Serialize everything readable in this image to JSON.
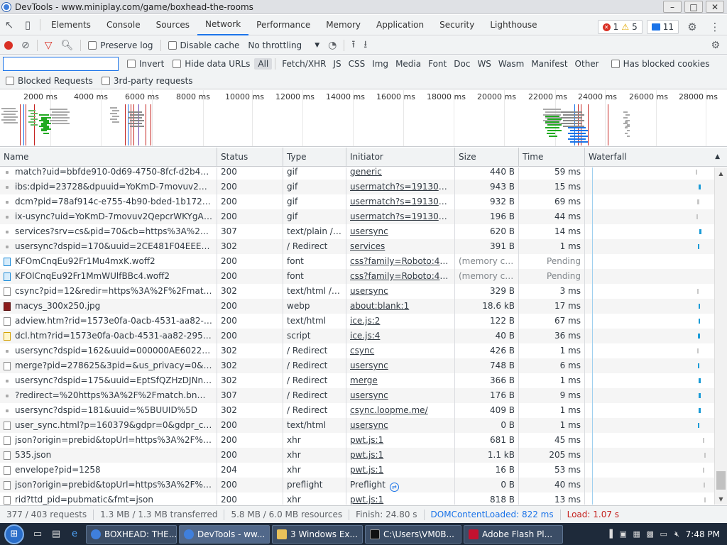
{
  "window": {
    "title": "DevTools - www.miniplay.com/game/boxhead-the-rooms",
    "min": "–",
    "max": "□",
    "close": "✕"
  },
  "tabs": [
    "Elements",
    "Console",
    "Sources",
    "Network",
    "Performance",
    "Memory",
    "Application",
    "Security",
    "Lighthouse"
  ],
  "badges": {
    "errors": "1",
    "warnings": "5",
    "messages": "11"
  },
  "toolbar": {
    "preserve_log": "Preserve log",
    "disable_cache": "Disable cache",
    "throttling": "No throttling"
  },
  "filter": {
    "value": "",
    "invert": "Invert",
    "hide_data_urls": "Hide data URLs",
    "types": [
      "All",
      "Fetch/XHR",
      "JS",
      "CSS",
      "Img",
      "Media",
      "Font",
      "Doc",
      "WS",
      "Wasm",
      "Manifest",
      "Other"
    ],
    "has_blocked_cookies": "Has blocked cookies",
    "blocked_requests": "Blocked Requests",
    "third_party": "3rd-party requests"
  },
  "overview_ticks": [
    "2000 ms",
    "4000 ms",
    "6000 ms",
    "8000 ms",
    "10000 ms",
    "12000 ms",
    "14000 ms",
    "16000 ms",
    "18000 ms",
    "20000 ms",
    "22000 ms",
    "24000 ms",
    "26000 ms",
    "28000 ms"
  ],
  "columns": {
    "name": "Name",
    "status": "Status",
    "type": "Type",
    "initiator": "Initiator",
    "size": "Size",
    "time": "Time",
    "waterfall": "Waterfall"
  },
  "rows": [
    {
      "name": "match?uid=bbfde910-0d69-4750-8fcf-d2b4ac631...",
      "icon": "dot",
      "status": "200",
      "type": "gif",
      "initiator": "generic",
      "init_link": true,
      "size": "440 B",
      "time": "59 ms",
      "wf": "grey"
    },
    {
      "name": "ibs:dpid=23728&dpuuid=YoKmD-7movuv2Qepcr...",
      "icon": "dot",
      "status": "200",
      "type": "gif",
      "initiator": "usermatch?s=191306&cb...",
      "init_link": true,
      "size": "943 B",
      "time": "15 ms",
      "wf": "blue"
    },
    {
      "name": "dcm?pid=78af914c-e755-4b90-bded-1b172aedc7...",
      "icon": "dot",
      "status": "200",
      "type": "gif",
      "initiator": "usermatch?s=191306&cb...",
      "init_link": true,
      "size": "932 B",
      "time": "69 ms",
      "wf": "grey"
    },
    {
      "name": "ix-usync?uid=YoKmD-7movuv2QepcrWKYgAA%2...",
      "icon": "dot",
      "status": "200",
      "type": "gif",
      "initiator": "usermatch?s=191306&cb...",
      "init_link": true,
      "size": "196 B",
      "time": "44 ms",
      "wf": "grey"
    },
    {
      "name": "services?srv=cs&pid=70&cb=https%3A%2F%2Fm...",
      "icon": "dot",
      "status": "307",
      "type": "text/plain / R...",
      "initiator": "usersync",
      "init_link": true,
      "size": "620 B",
      "time": "14 ms",
      "wf": "blue"
    },
    {
      "name": "usersync?dspid=170&uuid=2CE481F04EEE40A68...",
      "icon": "dot",
      "status": "302",
      "type": "/ Redirect",
      "initiator": "services",
      "init_link": true,
      "size": "391 B",
      "time": "1 ms",
      "wf": "blue"
    },
    {
      "name": "KFOmCnqEu92Fr1Mu4mxK.woff2",
      "icon": "font",
      "status": "200",
      "type": "font",
      "initiator": "css?family=Roboto:400,7...",
      "init_link": true,
      "size": "(memory cac...",
      "size_muted": true,
      "time": "Pending",
      "time_muted": true,
      "wf": "none"
    },
    {
      "name": "KFOlCnqEu92Fr1MmWUlfBBc4.woff2",
      "icon": "font",
      "status": "200",
      "type": "font",
      "initiator": "css?family=Roboto:400,7...",
      "init_link": true,
      "size": "(memory cac...",
      "size_muted": true,
      "time": "Pending",
      "time_muted": true,
      "wf": "none"
    },
    {
      "name": "csync?pid=12&redir=https%3A%2F%2Fmatch.bn...",
      "icon": "doc",
      "status": "302",
      "type": "text/html / R...",
      "initiator": "usersync",
      "init_link": true,
      "size": "329 B",
      "time": "3 ms",
      "wf": "grey"
    },
    {
      "name": "macys_300x250.jpg",
      "icon": "img",
      "status": "200",
      "type": "webp",
      "initiator": "about:blank:1",
      "init_link": true,
      "size": "18.6 kB",
      "time": "17 ms",
      "wf": "blue"
    },
    {
      "name": "adview.htm?rid=1573e0fa-0acb-4531-aa82-29581...",
      "icon": "doc",
      "status": "200",
      "type": "text/html",
      "initiator": "ice.js:2",
      "init_link": true,
      "size": "122 B",
      "time": "67 ms",
      "wf": "blue"
    },
    {
      "name": "dcl.htm?rid=1573e0fa-0acb-4531-aa82-295812b0...",
      "icon": "script",
      "status": "200",
      "type": "script",
      "initiator": "ice.js:4",
      "init_link": true,
      "size": "40 B",
      "time": "36 ms",
      "wf": "blue"
    },
    {
      "name": "usersync?dspid=162&uuid=000000AE602265C5",
      "icon": "dot",
      "status": "302",
      "type": "/ Redirect",
      "initiator": "csync",
      "init_link": true,
      "size": "426 B",
      "time": "1 ms",
      "wf": "grey"
    },
    {
      "name": "merge?pid=278625&3pid=&us_privacy=0&gdpr=...",
      "icon": "doc",
      "status": "302",
      "type": "/ Redirect",
      "initiator": "usersync",
      "init_link": true,
      "size": "748 B",
      "time": "6 ms",
      "wf": "blue"
    },
    {
      "name": "usersync?dspid=175&uuid=EptSfQZHzDJNnftQSE...",
      "icon": "dot",
      "status": "302",
      "type": "/ Redirect",
      "initiator": "merge",
      "init_link": true,
      "size": "366 B",
      "time": "1 ms",
      "wf": "blue"
    },
    {
      "name": "?redirect=%20https%3A%2F%2Fmatch.bnmla.com...",
      "icon": "dot",
      "status": "307",
      "type": "/ Redirect",
      "initiator": "usersync",
      "init_link": true,
      "size": "176 B",
      "time": "9 ms",
      "wf": "blue"
    },
    {
      "name": "usersync?dspid=181&uuid=%5BUUID%5D",
      "icon": "dot",
      "status": "302",
      "type": "/ Redirect",
      "initiator": "csync.loopme.me/",
      "init_link": true,
      "size": "409 B",
      "time": "1 ms",
      "wf": "blue"
    },
    {
      "name": "user_sync.html?p=160379&gdpr=0&gdpr_consen...",
      "icon": "doc",
      "status": "200",
      "type": "text/html",
      "initiator": "usersync",
      "init_link": true,
      "size": "0 B",
      "time": "1 ms",
      "wf": "blue"
    },
    {
      "name": "json?origin=prebid&topUrl=https%3A%2F%2Fww...",
      "icon": "doc",
      "status": "200",
      "type": "xhr",
      "initiator": "pwt.js:1",
      "init_link": true,
      "size": "681 B",
      "time": "45 ms",
      "wf": "grey"
    },
    {
      "name": "535.json",
      "icon": "doc",
      "status": "200",
      "type": "xhr",
      "initiator": "pwt.js:1",
      "init_link": true,
      "size": "1.1 kB",
      "time": "205 ms",
      "wf": "grey"
    },
    {
      "name": "envelope?pid=1258",
      "icon": "doc",
      "status": "204",
      "type": "xhr",
      "initiator": "pwt.js:1",
      "init_link": true,
      "size": "16 B",
      "time": "53 ms",
      "wf": "grey"
    },
    {
      "name": "json?origin=prebid&topUrl=https%3A%2F%2Fww...",
      "icon": "doc",
      "status": "200",
      "type": "preflight",
      "initiator": "Preflight",
      "init_link": false,
      "preflight": true,
      "size": "0 B",
      "time": "40 ms",
      "wf": "grey"
    },
    {
      "name": "rid?ttd_pid=pubmatic&fmt=json",
      "icon": "doc",
      "status": "200",
      "type": "xhr",
      "initiator": "pwt.js:1",
      "init_link": true,
      "size": "818 B",
      "time": "13 ms",
      "wf": "grey"
    }
  ],
  "status_bar": {
    "requests": "377 / 403 requests",
    "transferred": "1.3 MB / 1.3 MB transferred",
    "resources": "5.8 MB / 6.0 MB resources",
    "finish": "Finish: 24.80 s",
    "dcl": "DOMContentLoaded: 822 ms",
    "load": "Load: 1.07 s"
  },
  "taskbar": {
    "items": [
      "BOXHEAD: THE...",
      "DevTools - ww...",
      "3 Windows Ex...",
      "C:\\Users\\VM0B...",
      "Adobe Flash Pl..."
    ],
    "clock": "7:48 PM"
  },
  "colors": {
    "accent": "#1a73e8",
    "error": "#d93025",
    "record": "#d93025",
    "waterfall": "#1a9bd7"
  }
}
